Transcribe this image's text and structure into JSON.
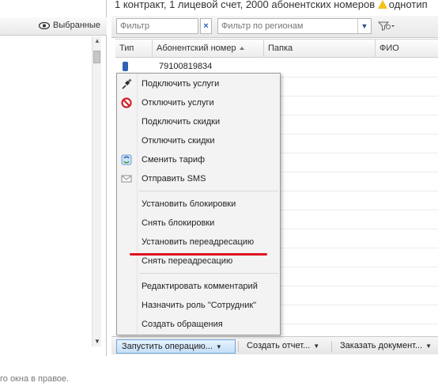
{
  "header": {
    "info_line": "1 контракт, 1 лицевой счет, 2000 абонентских номеров",
    "warning_text": "однотип"
  },
  "left_panel": {
    "favorites_label": "Выбранные"
  },
  "filters": {
    "filter_placeholder": "Фильтр",
    "clear_label": "×",
    "region_placeholder": "Фильтр по регионам"
  },
  "grid": {
    "columns": [
      "Тип",
      "Абонентский номер",
      "Папка",
      "ФИО"
    ],
    "first_row_number": "79100819834"
  },
  "context_menu": {
    "group1": [
      {
        "label": "Подключить услуги",
        "icon": "plug-icon"
      },
      {
        "label": "Отключить услуги",
        "icon": "forbidden-icon"
      },
      {
        "label": "Подключить скидки",
        "icon": ""
      },
      {
        "label": "Отключить скидки",
        "icon": ""
      },
      {
        "label": "Сменить тариф",
        "icon": "refresh-icon"
      },
      {
        "label": "Отправить SMS",
        "icon": "envelope-icon"
      }
    ],
    "group2": [
      {
        "label": "Установить блокировки"
      },
      {
        "label": "Снять блокировки"
      },
      {
        "label": "Установить переадресацию"
      },
      {
        "label": "Снять переадресацию"
      }
    ],
    "group3": [
      {
        "label": "Редактировать комментарий"
      },
      {
        "label": "Назначить роль \"Сотрудник\""
      },
      {
        "label": "Создать обращения"
      }
    ]
  },
  "bottom_bar": {
    "run_operation": "Запустить операцию...",
    "create_report": "Создать отчет...",
    "order_document": "Заказать документ..."
  },
  "footnote": "го окна в правое.",
  "colors": {
    "accent": "#2d62b5",
    "highlight_underline": "#e01021",
    "warning": "#f3c11a"
  }
}
